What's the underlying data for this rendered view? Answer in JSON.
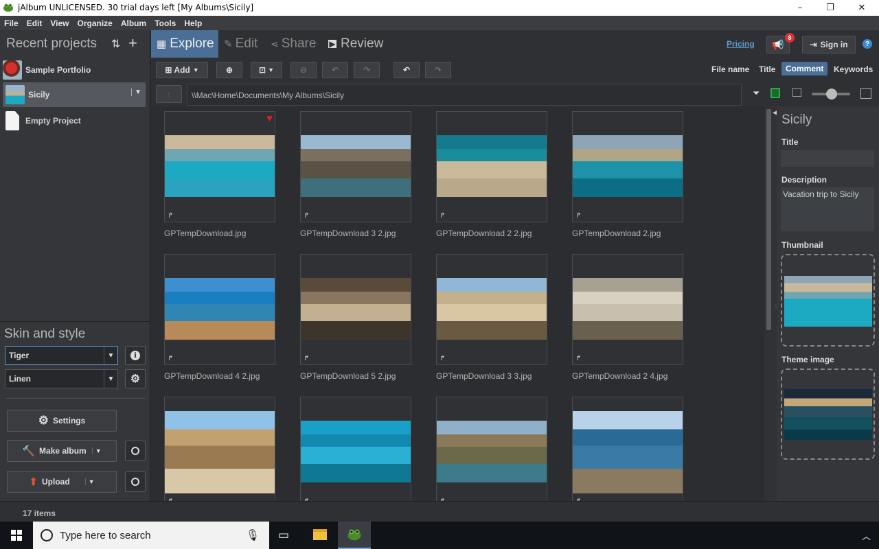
{
  "window": {
    "title": "jAlbum UNLICENSED. 30 trial days left [My Albums\\Sicily]",
    "minimize": "–",
    "maximize": "❐",
    "close": "✕"
  },
  "menu": [
    "File",
    "Edit",
    "View",
    "Organize",
    "Album",
    "Tools",
    "Help"
  ],
  "left": {
    "recent_title": "Recent projects",
    "projects": [
      {
        "label": "Sample Portfolio",
        "selected": false
      },
      {
        "label": "Sicily",
        "selected": true
      },
      {
        "label": "Empty Project",
        "selected": false
      }
    ],
    "skin_title": "Skin and style",
    "skin_value": "Tiger",
    "style_value": "Linen",
    "settings_label": "Settings",
    "make_album_label": "Make album",
    "upload_label": "Upload"
  },
  "tabs": [
    {
      "label": "Explore",
      "icon": "grid-icon",
      "active": true
    },
    {
      "label": "Edit",
      "icon": "pencil-icon",
      "active": false
    },
    {
      "label": "Share",
      "icon": "share-icon",
      "active": false
    },
    {
      "label": "Review",
      "icon": "play-icon",
      "active": false
    }
  ],
  "header": {
    "pricing": "Pricing",
    "notif_count": "8",
    "signin": "Sign in",
    "help": "?"
  },
  "toolbar": {
    "add_label": "Add"
  },
  "sort": {
    "options": [
      "File name",
      "Title",
      "Comment",
      "Keywords"
    ],
    "active": "Comment"
  },
  "path": "\\\\Mac\\Home\\Documents\\My Albums\\Sicily",
  "files": [
    {
      "name": "GPTempDownload.jpg",
      "favorite": true,
      "palette": [
        "#c9b89a",
        "#6fa6b2",
        "#1ca9c2",
        "#2aa3c0"
      ]
    },
    {
      "name": "GPTempDownload 3 2.jpg",
      "favorite": false,
      "palette": [
        "#9ab9d0",
        "#7a7060",
        "#5a5244",
        "#3d6f7c"
      ]
    },
    {
      "name": "GPTempDownload 2 2.jpg",
      "favorite": false,
      "palette": [
        "#157a8c",
        "#1a8d9c",
        "#c9b99a",
        "#b9a98a"
      ]
    },
    {
      "name": "GPTempDownload 2.jpg",
      "favorite": false,
      "palette": [
        "#8ea5b8",
        "#b0a686",
        "#1d92a8",
        "#0e6d86"
      ]
    },
    {
      "name": "GPTempDownload 4 2.jpg",
      "favorite": false,
      "palette": [
        "#3c8fd0",
        "#1a7fc0",
        "#2f86b5",
        "#b78a5a"
      ]
    },
    {
      "name": "GPTempDownload 5 2.jpg",
      "favorite": false,
      "palette": [
        "#5a4a3a",
        "#8a7660",
        "#c2b090",
        "#3d342a"
      ]
    },
    {
      "name": "GPTempDownload 3 3.jpg",
      "favorite": false,
      "palette": [
        "#8fb8d6",
        "#c4b08c",
        "#d8c7a2",
        "#6a5a44"
      ]
    },
    {
      "name": "GPTempDownload 2 4.jpg",
      "favorite": false,
      "palette": [
        "#a8a090",
        "#d8d0c0",
        "#c8bfae",
        "#6a6050"
      ]
    },
    {
      "name": "",
      "favorite": false,
      "palette": [
        "#8ec2e6",
        "#c2a070",
        "#9a7a50",
        "#d8c8a8"
      ]
    },
    {
      "name": "",
      "favorite": false,
      "palette": [
        "#1aa0c8",
        "#128ab0",
        "#2ab0d4",
        "#0e7896"
      ]
    },
    {
      "name": "",
      "favorite": false,
      "palette": [
        "#8fb0c8",
        "#8a7a5a",
        "#6a6a4a",
        "#3a7a8a"
      ]
    },
    {
      "name": "",
      "favorite": false,
      "palette": [
        "#b8d2ea",
        "#2a6a96",
        "#3a7aa6",
        "#8a7a62"
      ]
    }
  ],
  "right": {
    "title": "Sicily",
    "title_label": "Title",
    "title_value": "",
    "desc_label": "Description",
    "desc_value": "Vacation trip to Sicily",
    "thumb_label": "Thumbnail",
    "theme_label": "Theme image"
  },
  "status": {
    "count": "17 items"
  },
  "taskbar": {
    "search_placeholder": "Type here to search"
  },
  "colors": {
    "accent": "#4a6e95",
    "favorite": "#e01e2a",
    "badge": "#e03030"
  }
}
